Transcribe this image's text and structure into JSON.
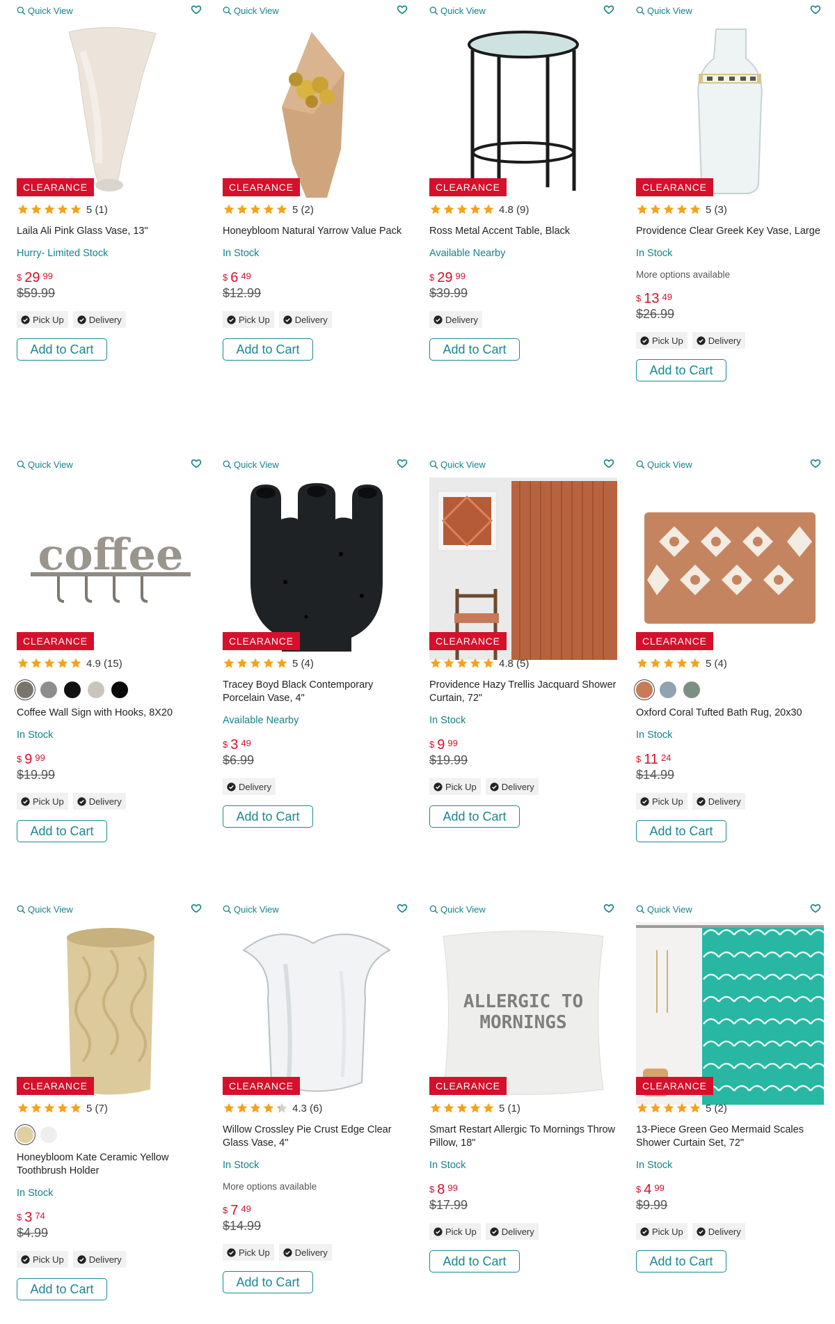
{
  "common": {
    "quick_view": "Quick View",
    "clearance": "CLEARANCE",
    "add_to_cart": "Add to Cart",
    "pick_up": "Pick Up",
    "delivery": "Delivery",
    "currency": "$",
    "accent": "#16818a",
    "clearance_color": "#d5102b"
  },
  "products": [
    {
      "title": "Laila Ali Pink Glass Vase, 13\"",
      "rating": 5,
      "rating_text": "5 (1)",
      "availability": "Hurry- Limited Stock",
      "more": "",
      "price_dollars": "29",
      "price_cents": "99",
      "was": "$59.99",
      "pickup": true,
      "delivery": true,
      "swatches": [],
      "image": "vase-pink"
    },
    {
      "title": "Honeybloom Natural Yarrow Value Pack",
      "rating": 5,
      "rating_text": "5 (2)",
      "availability": "In Stock",
      "more": "",
      "price_dollars": "6",
      "price_cents": "49",
      "was": "$12.99",
      "pickup": true,
      "delivery": true,
      "swatches": [],
      "image": "yarrow"
    },
    {
      "title": "Ross Metal Accent Table, Black",
      "rating": 5,
      "rating_text": "4.8 (9)",
      "availability": "Available Nearby",
      "more": "",
      "price_dollars": "29",
      "price_cents": "99",
      "was": "$39.99",
      "pickup": false,
      "delivery": true,
      "swatches": [],
      "image": "table"
    },
    {
      "title": "Providence Clear Greek Key Vase, Large",
      "rating": 5,
      "rating_text": "5 (3)",
      "availability": "In Stock",
      "more": "More options available",
      "price_dollars": "13",
      "price_cents": "49",
      "was": "$26.99",
      "pickup": true,
      "delivery": true,
      "swatches": [],
      "image": "vase-clear"
    },
    {
      "title": "Coffee Wall Sign with Hooks, 8X20",
      "rating": 5,
      "rating_text": "4.9 (15)",
      "availability": "In Stock",
      "more": "",
      "price_dollars": "9",
      "price_cents": "99",
      "was": "$19.99",
      "pickup": true,
      "delivery": true,
      "swatches": [
        "#7a746b",
        "#8d8d8d",
        "#111111",
        "#c9c5bc",
        "#0a0a0a"
      ],
      "image": "coffee"
    },
    {
      "title": "Tracey Boyd Black Contemporary Porcelain Vase, 4\"",
      "rating": 5,
      "rating_text": "5 (4)",
      "availability": "Available Nearby",
      "more": "",
      "price_dollars": "3",
      "price_cents": "49",
      "was": "$6.99",
      "pickup": false,
      "delivery": true,
      "swatches": [],
      "image": "vase-black"
    },
    {
      "title": "Providence Hazy Trellis Jacquard Shower Curtain, 72\"",
      "rating": 5,
      "rating_text": "4.8 (5)",
      "availability": "In Stock",
      "more": "",
      "price_dollars": "9",
      "price_cents": "99",
      "was": "$19.99",
      "pickup": true,
      "delivery": true,
      "swatches": [],
      "image": "curtain-rust"
    },
    {
      "title": "Oxford Coral Tufted Bath Rug, 20x30",
      "rating": 5,
      "rating_text": "5 (4)",
      "availability": "In Stock",
      "more": "",
      "price_dollars": "11",
      "price_cents": "24",
      "was": "$14.99",
      "pickup": true,
      "delivery": true,
      "swatches": [
        "#c97a56",
        "#8fa3b3",
        "#7d8f82"
      ],
      "image": "rug"
    },
    {
      "title": "Honeybloom Kate Ceramic Yellow Toothbrush Holder",
      "rating": 5,
      "rating_text": "5 (7)",
      "availability": "In Stock",
      "more": "",
      "price_dollars": "3",
      "price_cents": "74",
      "was": "$4.99",
      "pickup": true,
      "delivery": true,
      "swatches": [
        "#e0cfa0",
        "#eeeeee"
      ],
      "image": "holder"
    },
    {
      "title": "Willow Crossley Pie Crust Edge Clear Glass Vase, 4\"",
      "rating": 4.3,
      "rating_text": "4.3 (6)",
      "availability": "In Stock",
      "more": "More options available",
      "price_dollars": "7",
      "price_cents": "49",
      "was": "$14.99",
      "pickup": true,
      "delivery": true,
      "swatches": [],
      "image": "vase-glass"
    },
    {
      "title": "Smart Restart Allergic To Mornings Throw Pillow, 18\"",
      "rating": 5,
      "rating_text": "5 (1)",
      "availability": "In Stock",
      "more": "",
      "price_dollars": "8",
      "price_cents": "99",
      "was": "$17.99",
      "pickup": true,
      "delivery": true,
      "swatches": [],
      "image": "pillow",
      "pillow_text": [
        "ALLERGIC TO",
        "MORNINGS"
      ]
    },
    {
      "title": "13-Piece Green Geo Mermaid Scales Shower Curtain Set, 72\"",
      "rating": 5,
      "rating_text": "5 (2)",
      "availability": "In Stock",
      "more": "",
      "price_dollars": "4",
      "price_cents": "99",
      "was": "$9.99",
      "pickup": true,
      "delivery": true,
      "swatches": [],
      "image": "curtain-green"
    }
  ]
}
